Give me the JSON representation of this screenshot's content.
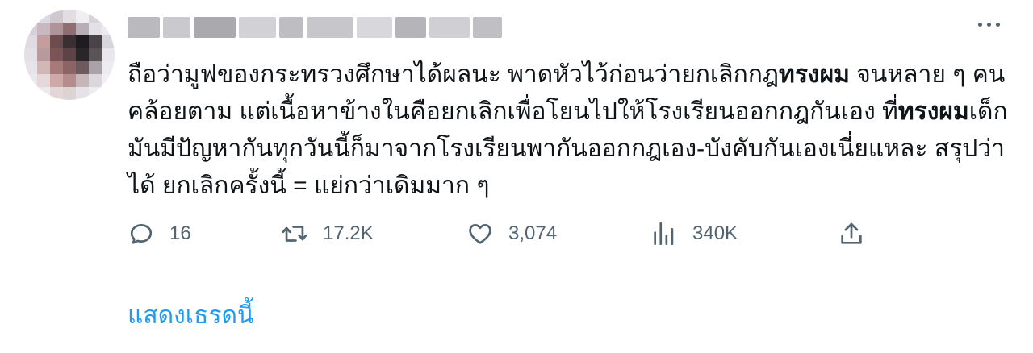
{
  "tweet": {
    "text": [
      {
        "t": "ถือว่ามูฟของกระทรวงศึกษาได้ผลนะ พาดหัวไว้ก่อนว่ายกเลิกกฎ",
        "bold": false
      },
      {
        "t": "ทรงผม",
        "bold": true
      },
      {
        "t": " จนหลาย ๆ คนคล้อยตาม แต่เนื้อหาข้างในคือยกเลิกเพื่อโยนไปให้โรงเรียนออกกฎกันเอง ที่",
        "bold": false
      },
      {
        "t": "ทรงผม",
        "bold": true
      },
      {
        "t": "เด็กมันมีปัญหากันทุกวันนี้ก็มาจากโรงเรียนพากันออกกฎเอง-บังคับกันเองเนี่ยแหละ สรุปว่าได้ ยกเลิกครั้งนี้ = แย่กว่าเดิมมาก ๆ",
        "bold": false
      }
    ]
  },
  "actions": {
    "reply_count": "16",
    "retweet_count": "17.2K",
    "like_count": "3,074",
    "views_count": "340K"
  },
  "show_thread_label": "แสดงเธรดนี้",
  "icons": {
    "reply": "reply-icon",
    "retweet": "retweet-icon",
    "like": "heart-icon",
    "views": "views-icon",
    "share": "share-icon",
    "more": "more-icon"
  },
  "colors": {
    "text": "#0f1419",
    "secondary": "#536471",
    "link": "#1d9bf0"
  }
}
